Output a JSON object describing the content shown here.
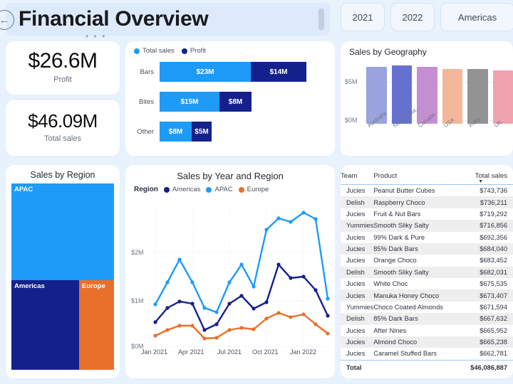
{
  "header": {
    "title": "Financial Overview",
    "back_icon": "back-arrow-icon",
    "dots": "• • •"
  },
  "filters": [
    {
      "label": "2021"
    },
    {
      "label": "2022"
    },
    {
      "label": "Americas"
    }
  ],
  "kpis": [
    {
      "value": "$26.6M",
      "label": "Profit"
    },
    {
      "value": "$46.09M",
      "label": "Total sales"
    }
  ],
  "colors": {
    "total_sales": "#1d9bf6",
    "profit": "#14218c",
    "americas": "#14218c",
    "apac": "#1d9bf6",
    "europe": "#e8702a",
    "background": "#e8f2fc",
    "card": "#ffffff"
  },
  "chart_data": [
    {
      "type": "bar",
      "name": "category-stacked-bars",
      "orientation": "horizontal",
      "stacked": true,
      "title": "",
      "categories": [
        "Bars",
        "Bites",
        "Other"
      ],
      "series": [
        {
          "name": "Total sales",
          "color": "#1d9bf6",
          "values": [
            23,
            15,
            8
          ],
          "labels": [
            "$23M",
            "$15M",
            "$8M"
          ]
        },
        {
          "name": "Profit",
          "color": "#14218c",
          "values": [
            14,
            8,
            5
          ],
          "labels": [
            "$14M",
            "$8M",
            "$5M"
          ]
        }
      ],
      "unit": "$M",
      "legend": [
        "Total sales",
        "Profit"
      ],
      "legend_position": "top-left"
    },
    {
      "type": "bar",
      "name": "sales-by-geography",
      "title": "Sales by Geography",
      "categories": [
        "Australia",
        "New Zeala...",
        "Canada",
        "USA",
        "India",
        "UK"
      ],
      "values": [
        5.75,
        5.8,
        5.7,
        5.6,
        5.6,
        5.5
      ],
      "bar_colors": [
        "#9aa3dd",
        "#6670cf",
        "#c38fd2",
        "#f4b79b",
        "#939393",
        "#f0a2ae"
      ],
      "ylabel": "",
      "yticks": [
        "$0M",
        "$5M"
      ],
      "ylim": [
        0,
        6.5
      ],
      "grid": true
    },
    {
      "type": "treemap",
      "name": "sales-by-region",
      "title": "Sales by Region",
      "categories": [
        "APAC",
        "Americas",
        "Europe"
      ],
      "values": [
        52,
        30,
        18
      ],
      "colors": [
        "#1d9bf6",
        "#14218c",
        "#e8702a"
      ]
    },
    {
      "type": "line",
      "name": "sales-by-year-and-region",
      "title": "Sales by Year and Region",
      "legend_title": "Region",
      "legend": [
        "Americas",
        "APAC",
        "Europe"
      ],
      "legend_position": "top-left",
      "xlabel": "",
      "ylabel": "",
      "x": [
        "Jan 2021",
        "Feb 2021",
        "Mar 2021",
        "Apr 2021",
        "May 2021",
        "Jun 2021",
        "Jul 2021",
        "Aug 2021",
        "Sep 2021",
        "Oct 2021",
        "Nov 2021",
        "Dec 2021",
        "Jan 2022",
        "Feb 2022",
        "Mar 2022",
        "Apr 2022"
      ],
      "xticks": [
        "Jan 2021",
        "Apr 2021",
        "Jul 2021",
        "Oct 2021",
        "Jan 2022"
      ],
      "yticks": [
        "$0M",
        "$1M",
        "$2M"
      ],
      "ylim": [
        0,
        2.6
      ],
      "grid": true,
      "series": [
        {
          "name": "Americas",
          "color": "#14218c",
          "values": [
            0.6,
            0.86,
            0.98,
            0.94,
            0.33,
            0.47,
            0.94,
            1.08,
            0.82,
            0.96,
            1.8,
            1.52,
            1.56,
            1.26,
            0.72
          ]
        },
        {
          "name": "APAC",
          "color": "#1d9bf6",
          "values": [
            0.93,
            1.33,
            1.75,
            1.33,
            0.7,
            0.62,
            1.33,
            1.65,
            1.22,
            2.16,
            2.37,
            2.28,
            2.47,
            2.32,
            1.08
          ]
        },
        {
          "name": "Europe",
          "color": "#e8702a",
          "values": [
            0.27,
            0.42,
            0.5,
            0.5,
            0.22,
            0.24,
            0.42,
            0.46,
            0.44,
            0.68,
            0.85,
            0.76,
            0.82,
            0.58,
            0.33
          ]
        }
      ]
    }
  ],
  "table": {
    "name": "product-sales-table",
    "columns": [
      "Team",
      "Product",
      "Total sales"
    ],
    "sort_column": "Total sales",
    "sort_direction": "descending",
    "rows": [
      {
        "team": "Jucies",
        "product": "Peanut Butter Cubes",
        "total_sales": "$743,736"
      },
      {
        "team": "Delish",
        "product": "Raspberry Choco",
        "total_sales": "$736,211"
      },
      {
        "team": "Jucies",
        "product": "Fruit & Nut Bars",
        "total_sales": "$719,292"
      },
      {
        "team": "Yummies",
        "product": "Smooth Sliky Salty",
        "total_sales": "$716,856"
      },
      {
        "team": "Jucies",
        "product": "99% Dark & Pure",
        "total_sales": "$692,356"
      },
      {
        "team": "Jucies",
        "product": "85% Dark Bars",
        "total_sales": "$684,040"
      },
      {
        "team": "Jucies",
        "product": "Orange Choco",
        "total_sales": "$683,452"
      },
      {
        "team": "Delish",
        "product": "Smooth Sliky Salty",
        "total_sales": "$682,031"
      },
      {
        "team": "Jucies",
        "product": "White Choc",
        "total_sales": "$675,535"
      },
      {
        "team": "Jucies",
        "product": "Manuka Honey Choco",
        "total_sales": "$673,407"
      },
      {
        "team": "Yummies",
        "product": "Choco Coated Almonds",
        "total_sales": "$671,594"
      },
      {
        "team": "Delish",
        "product": "85% Dark Bars",
        "total_sales": "$667,632"
      },
      {
        "team": "Jucies",
        "product": "After Nines",
        "total_sales": "$665,952"
      },
      {
        "team": "Jucies",
        "product": "Almond Choco",
        "total_sales": "$665,238"
      },
      {
        "team": "Jucies",
        "product": "Caramel Stuffed Bars",
        "total_sales": "$662,781"
      }
    ],
    "footer": {
      "label": "Total",
      "total_sales": "$46,086,887"
    }
  }
}
